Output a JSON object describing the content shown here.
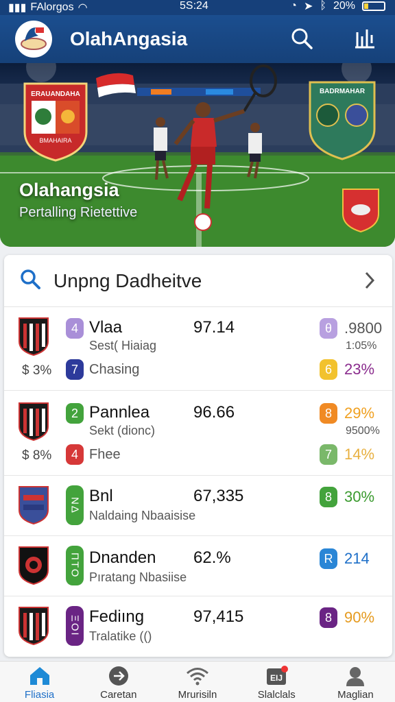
{
  "status": {
    "carrier": "FAlorgos",
    "time": "5S:24",
    "battery": "20%"
  },
  "header": {
    "title": "OlahAngasia"
  },
  "hero": {
    "title": "Olahangsia",
    "subtitle": "Pertalling Rietettive",
    "left_crest_text": "ERAUANDAHA",
    "left_crest_footer": "BMAHAIRA",
    "right_crest_text": "BADRMAHAR"
  },
  "card": {
    "title": "Unpng Dadheitve",
    "rows": [
      {
        "name": "Vlaa",
        "sub": "Sest( Hiaiag",
        "value": "97.14",
        "badge": "4",
        "badge_color": "#a98fd8",
        "pct": "3%",
        "sec_badge": "7",
        "sec_color": "#2d3a9b",
        "sec_label": "Chasing",
        "right_badge": "θ",
        "right_badge_color": "#b8a0e0",
        "right_value": ".9800",
        "right_value_color": "#555",
        "right_sub": "1:05%",
        "right2_badge": "6",
        "right2_badge_color": "#f2c22e",
        "right2_value": "23%",
        "right2_color": "#8a2c8d"
      },
      {
        "name": "Pannlea",
        "sub": "Sekt (dionc)",
        "value": "96.66",
        "badge": "2",
        "badge_color": "#43a33c",
        "pct": "8%",
        "sec_badge": "4",
        "sec_color": "#d63838",
        "sec_label": "Fhee",
        "right_badge": "8",
        "right_badge_color": "#f08a24",
        "right_value": "29%",
        "right_value_color": "#f0a020",
        "right_sub": "9500%",
        "right2_badge": "7",
        "right2_badge_color": "#7ab86a",
        "right2_value": "14%",
        "right2_color": "#e8b040"
      },
      {
        "name": "Bnl",
        "sub": "Naldaing Nbaaisise",
        "value": "67,335",
        "badge": "ΝΔ",
        "badge_color": "#43a33c",
        "right_badge": "8",
        "right_badge_color": "#43a33c",
        "right_value": "30%",
        "right_value_color": "#3a9a2e"
      },
      {
        "name": "Dnanden",
        "sub": "Pıratang Nbasiise",
        "value": "62.%",
        "badge": "ΠΤΟ",
        "badge_color": "#43a33c",
        "right_badge": "R",
        "right_badge_color": "#2a86d6",
        "right_value": "214",
        "right_value_color": "#1e6fc8"
      },
      {
        "name": "Fediıng",
        "sub": "Tralatike (()",
        "value": "97,415",
        "badge": "ΞΟΙ",
        "badge_color": "#6a2484",
        "right_badge": "8",
        "right_badge_color": "#6a2484",
        "right_value": "90%",
        "right_value_color": "#e59a1e"
      }
    ]
  },
  "nav": {
    "items": [
      {
        "label": "Fliasia",
        "icon": "home-icon"
      },
      {
        "label": "Caretan",
        "icon": "arrow-circle-icon"
      },
      {
        "label": "Mrurisiln",
        "icon": "wifi-icon"
      },
      {
        "label": "Slalclals",
        "icon": "calendar-icon",
        "badge": true,
        "badge_text": "EIJ"
      },
      {
        "label": "Maglian",
        "icon": "profile-icon"
      }
    ]
  },
  "colors": {
    "primary": "#16407a",
    "accent": "#1e6fc8"
  }
}
